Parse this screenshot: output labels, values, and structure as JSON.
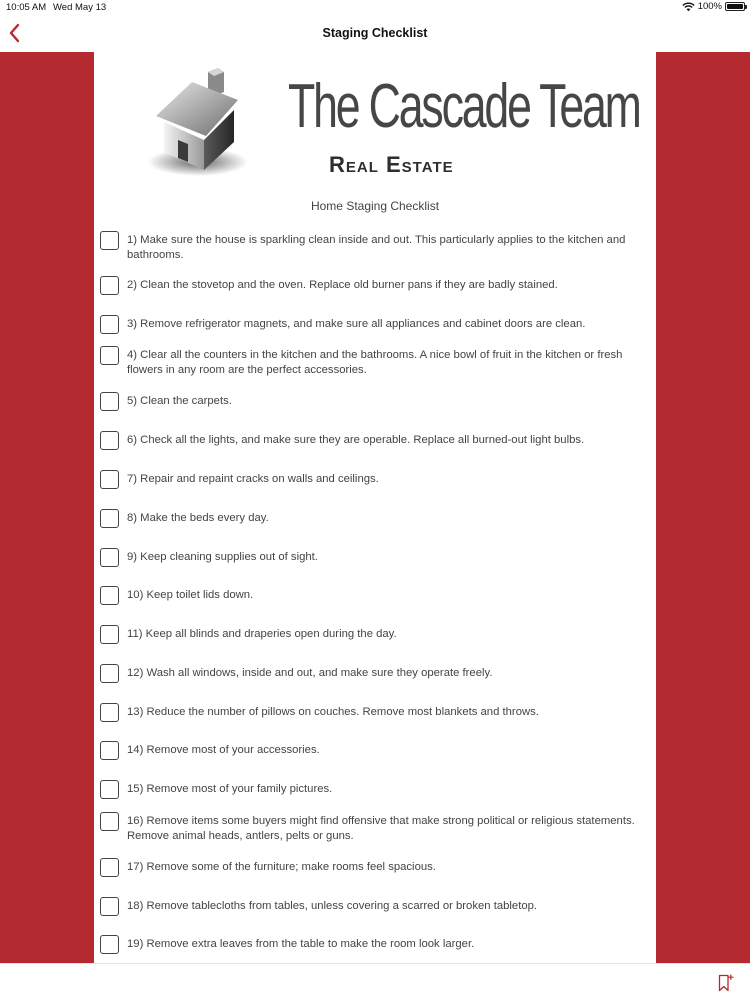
{
  "status_bar": {
    "time": "10:05 AM",
    "date": "Wed May 13",
    "battery": "100%",
    "wifi_icon": "wifi-icon",
    "battery_icon": "battery-icon"
  },
  "nav": {
    "title": "Staging Checklist",
    "back_icon": "chevron-left-icon"
  },
  "logo": {
    "brand": "The Cascade Team",
    "sub": "Real Estate"
  },
  "subtitle": "Home Staging Checklist",
  "items": [
    "1) Make sure the house is sparkling clean inside and out. This particularly applies to the kitchen and bathrooms.",
    "2) Clean the stovetop and the oven. Replace old burner pans if they are badly stained.",
    "3) Remove refrigerator magnets, and make sure all appliances and cabinet doors are clean.",
    "4) Clear all the counters in the kitchen and the bathrooms. A nice bowl of fruit in the kitchen or fresh flowers in any room are the perfect accessories.",
    "5) Clean the carpets.",
    "6) Check all the lights, and make sure they are operable. Replace all burned-out light bulbs.",
    "7) Repair and repaint cracks on walls and ceilings.",
    "8) Make the beds every day.",
    "9) Keep cleaning supplies out of sight.",
    "10) Keep toilet lids down.",
    "11) Keep all blinds and draperies open during the day.",
    "12) Wash all windows, inside and out, and make sure they operate freely.",
    "13) Reduce the number of pillows on couches. Remove most blankets and throws.",
    "14) Remove most of your accessories.",
    "15) Remove most of your family pictures.",
    "16) Remove items some buyers might find offensive that make strong political or religious statements. Remove animal heads, antlers, pelts or guns.",
    "17) Remove some of the furniture; make rooms feel spacious.",
    "18) Remove tablecloths from tables, unless covering a scarred or broken tabletop.",
    "19) Remove extra leaves from the table to make the room look larger."
  ],
  "colors": {
    "accent": "#b32a31",
    "text": "#444444"
  },
  "bottom_bar": {
    "bookmark_icon": "bookmark-add-icon"
  }
}
